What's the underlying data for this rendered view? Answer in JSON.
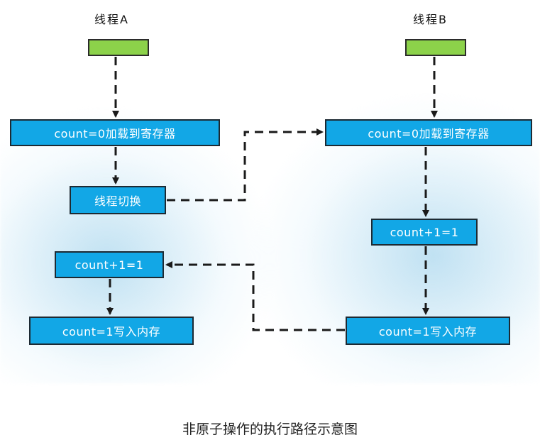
{
  "diagram": {
    "thread_a": {
      "title": "线程A",
      "steps": [
        "count=0加载到寄存器",
        "线程切换",
        "count+1=1",
        "count=1写入内存"
      ]
    },
    "thread_b": {
      "title": "线程B",
      "steps": [
        "count=0加载到寄存器",
        "count+1=1",
        "count=1写入内存"
      ]
    },
    "caption": "非原子操作的执行路径示意图",
    "colors": {
      "box_fill": "#12a7e6",
      "start_fill": "#8cd24a",
      "arrow": "#1a1a1a",
      "glow": "#b5dcf0"
    }
  }
}
